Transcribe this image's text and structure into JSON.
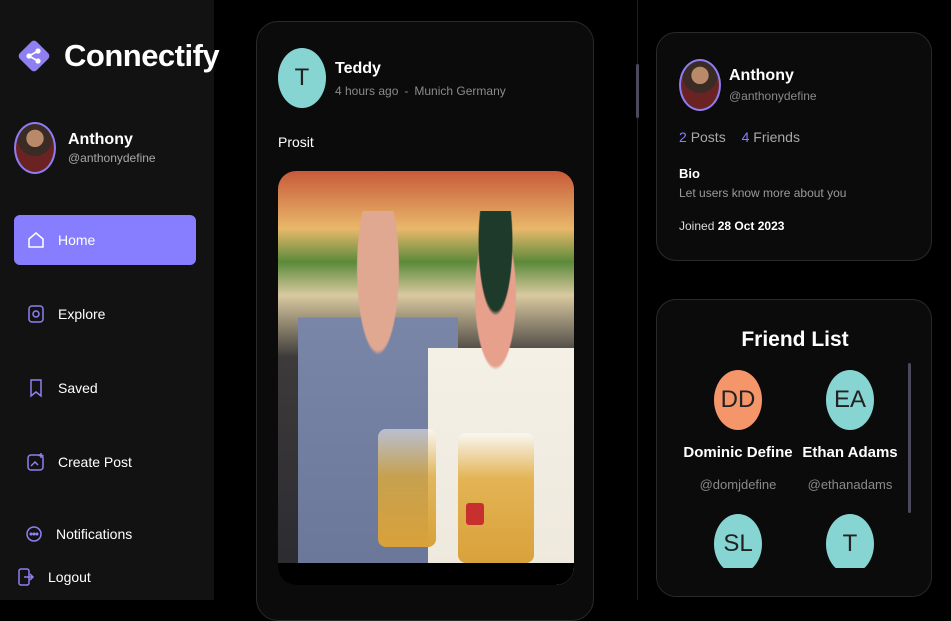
{
  "brand": {
    "name": "Connectify",
    "accent": "#877eff"
  },
  "current_user": {
    "name": "Anthony",
    "handle": "@anthonydefine"
  },
  "nav": [
    {
      "label": "Home",
      "icon": "home-icon",
      "active": true
    },
    {
      "label": "Explore",
      "icon": "explore-icon",
      "active": false
    },
    {
      "label": "Saved",
      "icon": "bookmark-icon",
      "active": false
    },
    {
      "label": "Create Post",
      "icon": "create-post-icon",
      "active": false
    },
    {
      "label": "Notifications",
      "icon": "notifications-icon",
      "active": false
    },
    {
      "label": "Logout",
      "icon": "logout-icon",
      "active": false
    }
  ],
  "post": {
    "author_initial": "T",
    "author": "Teddy",
    "time": "4 hours ago",
    "separator": "-",
    "location": "Munich Germany",
    "caption": "Prosit",
    "avatar_color": "#86d5d3"
  },
  "profile_card": {
    "name": "Anthony",
    "handle": "@anthonydefine",
    "posts_count": "2",
    "posts_label": "Posts",
    "friends_count": "4",
    "friends_label": "Friends",
    "bio_title": "Bio",
    "bio_text": "Let users know more about you",
    "joined_label": "Joined",
    "joined_date": "28 Oct 2023"
  },
  "friend_list": {
    "title": "Friend List",
    "friends": [
      {
        "initials": "DD",
        "name": "Dominic Define",
        "handle": "@domjdefine",
        "color": "#f4956a"
      },
      {
        "initials": "EA",
        "name": "Ethan Adams",
        "handle": "@ethanadams",
        "color": "#86d5d3"
      },
      {
        "initials": "SL",
        "name": "",
        "handle": "",
        "color": "#86d5d3"
      },
      {
        "initials": "T",
        "name": "",
        "handle": "",
        "color": "#86d5d3"
      }
    ]
  }
}
